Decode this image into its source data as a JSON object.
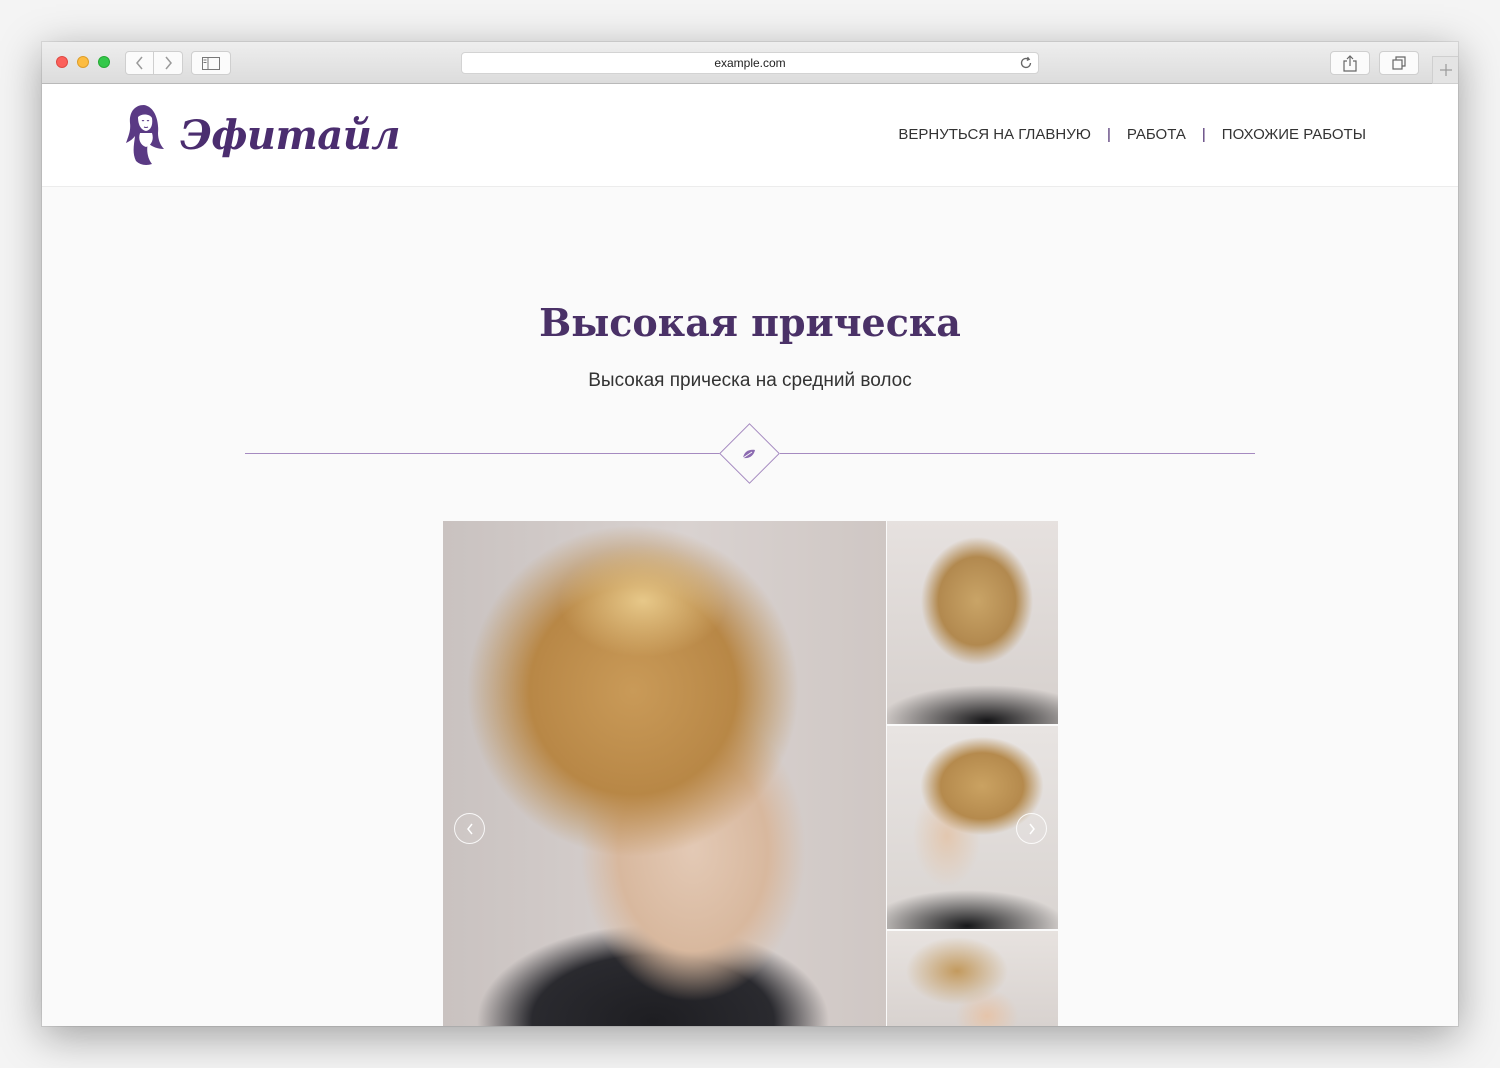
{
  "browser": {
    "url": "example.com"
  },
  "site": {
    "logo_text": "Эфитайл",
    "nav": [
      {
        "label": "ВЕРНУТЬСЯ НА ГЛАВНУЮ"
      },
      {
        "label": "РАБОТА"
      },
      {
        "label": "ПОХОЖИЕ РАБОТЫ"
      }
    ],
    "nav_separator": "|"
  },
  "content": {
    "title": "Высокая прическа",
    "subtitle": "Высокая прическа на средний волос"
  },
  "colors": {
    "brand": "#4b2d6f",
    "divider": "#a58ac0"
  },
  "icons": {
    "divider": "leaf-icon",
    "prev": "chevron-left-icon",
    "next": "chevron-right-icon"
  }
}
